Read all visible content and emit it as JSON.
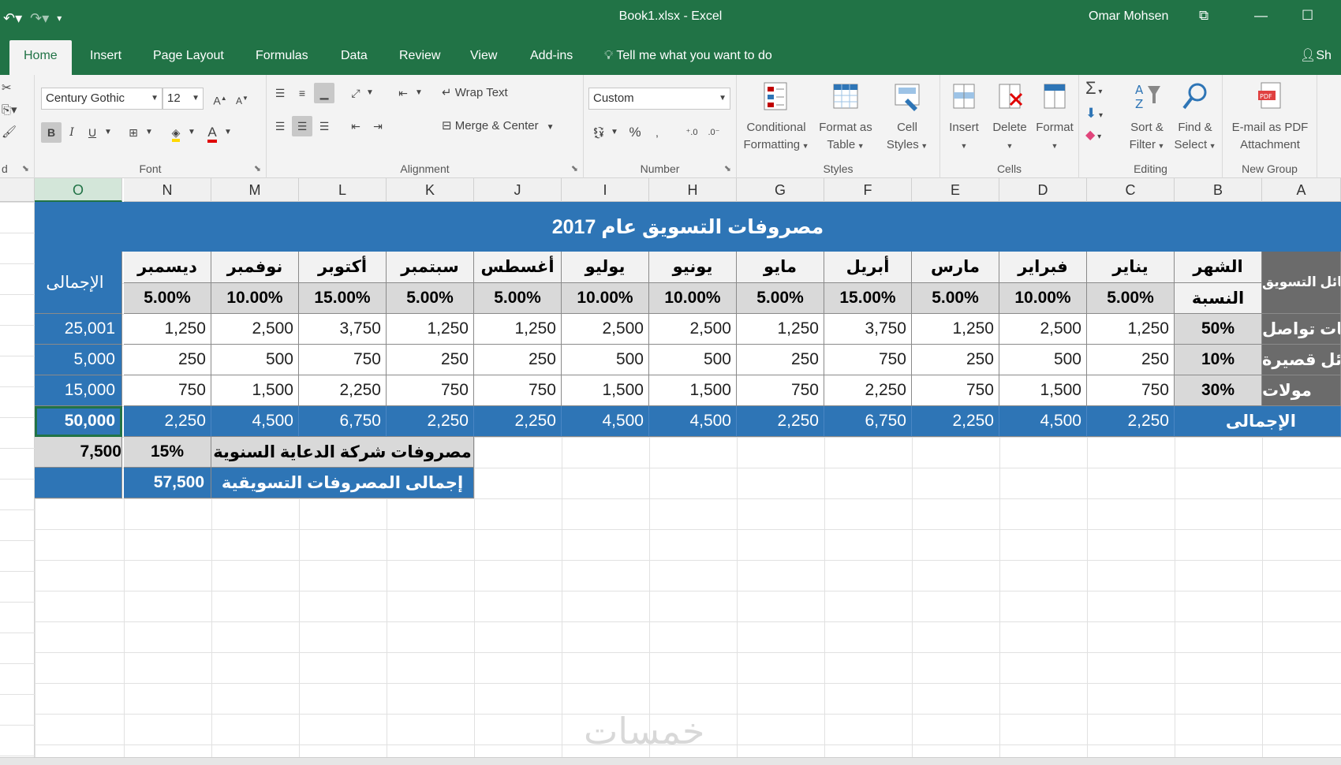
{
  "titlebar": {
    "doc_title": "Book1.xlsx  -  Excel",
    "user": "Omar Mohsen"
  },
  "tabs": [
    "Home",
    "Insert",
    "Page Layout",
    "Formulas",
    "Data",
    "Review",
    "View",
    "Add-ins"
  ],
  "tell_me": "Tell me what you want to do",
  "share": "Sh",
  "ribbon": {
    "font_name": "Century Gothic",
    "font_size": "12",
    "wrap_text": "Wrap Text",
    "merge_center": "Merge & Center",
    "number_format": "Custom",
    "percent": "%",
    "conditional_formatting": [
      "Conditional",
      "Formatting"
    ],
    "format_as_table": [
      "Format as",
      "Table"
    ],
    "cell_styles": [
      "Cell",
      "Styles"
    ],
    "insert": "Insert",
    "delete": "Delete",
    "format": "Format",
    "sort_filter": [
      "Sort &",
      "Filter"
    ],
    "find_select": [
      "Find &",
      "Select"
    ],
    "email_pdf": [
      "E-mail as PDF",
      "Attachment"
    ],
    "group_labels": {
      "clipboard": "d",
      "font": "Font",
      "alignment": "Alignment",
      "number": "Number",
      "styles": "Styles",
      "cells": "Cells",
      "editing": "Editing",
      "new_group": "New Group"
    }
  },
  "columns": [
    "O",
    "N",
    "M",
    "L",
    "K",
    "J",
    "I",
    "H",
    "G",
    "F",
    "E",
    "D",
    "C",
    "B",
    "A"
  ],
  "sheet": {
    "title": "مصروفات التسويق عام 2017",
    "row_label_header": "وسائل التسويق",
    "month_header": "الشهر",
    "ratio_header": "النسبة",
    "total_header": "الإجمالى",
    "months": [
      "يناير",
      "فبراير",
      "مارس",
      "أبريل",
      "مايو",
      "يونيو",
      "يوليو",
      "أغسطس",
      "سبتمبر",
      "أكتوبر",
      "نوفمبر",
      "ديسمبر"
    ],
    "month_pcts": [
      "5.00%",
      "10.00%",
      "5.00%",
      "15.00%",
      "5.00%",
      "10.00%",
      "10.00%",
      "5.00%",
      "5.00%",
      "15.00%",
      "10.00%",
      "5.00%"
    ],
    "rows": [
      {
        "label": "شبكات تواصل",
        "share": "50%",
        "values": [
          "1,250",
          "2,500",
          "1,250",
          "3,750",
          "1,250",
          "2,500",
          "2,500",
          "1,250",
          "1,250",
          "3,750",
          "2,500",
          "1,250"
        ],
        "total": "25,001"
      },
      {
        "label": "رسائل قصيرة",
        "share": "10%",
        "values": [
          "250",
          "500",
          "250",
          "750",
          "250",
          "500",
          "500",
          "250",
          "250",
          "750",
          "500",
          "250"
        ],
        "total": "5,000"
      },
      {
        "label": "مولات",
        "share": "30%",
        "values": [
          "750",
          "1,500",
          "750",
          "2,250",
          "750",
          "1,500",
          "1,500",
          "750",
          "750",
          "2,250",
          "1,500",
          "750"
        ],
        "total": "15,000"
      }
    ],
    "total_row": {
      "label": "الإجمالى",
      "values": [
        "2,250",
        "4,500",
        "2,250",
        "6,750",
        "2,250",
        "4,500",
        "4,500",
        "2,250",
        "2,250",
        "6,750",
        "4,500",
        "2,250"
      ],
      "grand_total": "50,000"
    },
    "agency": {
      "label": "مصروفات شركة الدعاية  السنوية",
      "pct": "15%",
      "value": "7,500"
    },
    "overall": {
      "label": "إجمالى المصروفات التسويقية",
      "value": "57,500"
    }
  },
  "watermark": "خمسات"
}
